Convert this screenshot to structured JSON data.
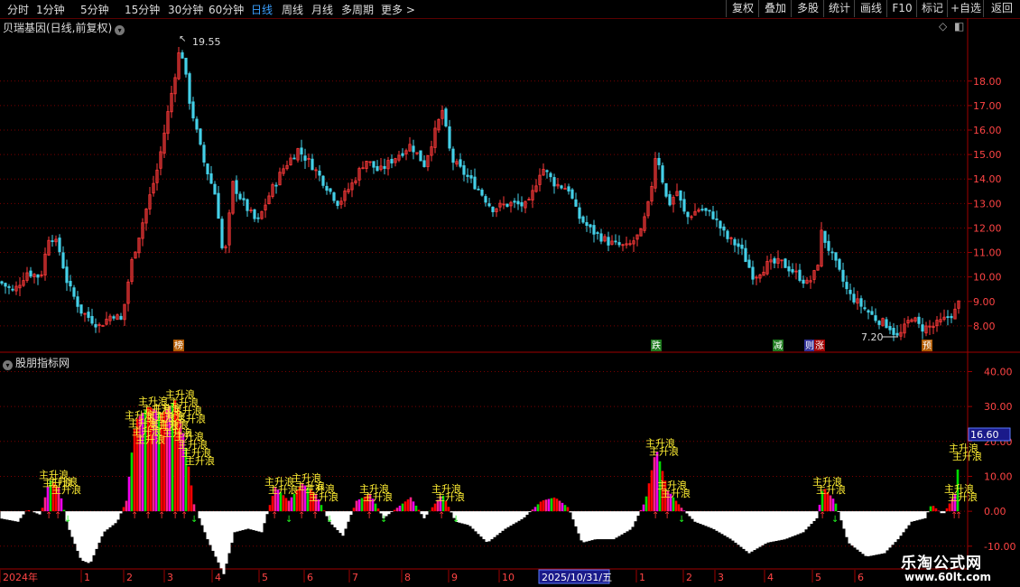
{
  "toolbar": {
    "periods": [
      "分时",
      "1分钟",
      "5分钟",
      "15分钟",
      "30分钟",
      "60分钟",
      "日线",
      "周线",
      "月线",
      "多周期",
      "更多"
    ],
    "active_period": "日线",
    "right_buttons": [
      "复权",
      "叠加",
      "多股",
      "统计",
      "画线",
      "F10",
      "标记",
      "+自选",
      "返回"
    ]
  },
  "main_panel": {
    "title": "贝瑞基因(日线,前复权)",
    "high_label": "19.55",
    "low_label": "7.20",
    "event_badges": [
      {
        "text": "榜",
        "color": "#b15a00",
        "x": 198
      },
      {
        "text": "跌",
        "color": "#1f7a1f",
        "x": 727
      },
      {
        "text": "减",
        "color": "#1f7a1f",
        "x": 862
      },
      {
        "text": "则",
        "color": "#333399",
        "x": 897
      },
      {
        "text": "涨",
        "color": "#a00000",
        "x": 908
      },
      {
        "text": "预",
        "color": "#b15a00",
        "x": 1027
      }
    ],
    "y_axis": {
      "min": 7.0,
      "max": 20.5,
      "ticks": [
        8,
        9,
        10,
        11,
        12,
        13,
        14,
        15,
        16,
        17,
        18
      ],
      "tick_labels": [
        "8.00",
        "9.00",
        "10.00",
        "11.00",
        "12.00",
        "13.00",
        "14.00",
        "15.00",
        "16.00",
        "17.00",
        "18.00"
      ]
    },
    "colors": {
      "up": "#ff3a3a",
      "down": "#44d0e8",
      "grid": "#7a0000"
    }
  },
  "sub_panel": {
    "title": "股朋指标网",
    "signal_label": "主升浪",
    "current_value_label": "16.60",
    "current_value": 16.6,
    "y_axis": {
      "min": -16,
      "max": 44,
      "ticks": [
        -10,
        0,
        10,
        20,
        30,
        40
      ],
      "tick_labels": [
        "-10.00",
        "0.00",
        "10.00",
        "20.00",
        "30.00",
        "40.00"
      ]
    }
  },
  "time_axis": {
    "labels": [
      {
        "text": "2024年",
        "x": 3
      },
      {
        "text": "1",
        "x": 93
      },
      {
        "text": "2",
        "x": 140
      },
      {
        "text": "3",
        "x": 185
      },
      {
        "text": "4",
        "x": 238
      },
      {
        "text": "5",
        "x": 290
      },
      {
        "text": "6",
        "x": 340
      },
      {
        "text": "7",
        "x": 390
      },
      {
        "text": "8",
        "x": 448
      },
      {
        "text": "9",
        "x": 500
      },
      {
        "text": "10",
        "x": 556
      },
      {
        "text": "1",
        "x": 708
      },
      {
        "text": "2",
        "x": 760
      },
      {
        "text": "3",
        "x": 795
      },
      {
        "text": "4",
        "x": 850
      },
      {
        "text": "5",
        "x": 903
      },
      {
        "text": "6",
        "x": 950
      }
    ],
    "cursor_date": "2025/10/31/五"
  },
  "chart_data": {
    "type": "line",
    "x_label": "",
    "y_label": "",
    "series": [
      {
        "points": [
          {
            "x": 0,
            "y": 9.8
          },
          {
            "x": 15,
            "y": 9.4
          },
          {
            "x": 30,
            "y": 10.2
          },
          {
            "x": 45,
            "y": 10.0
          },
          {
            "x": 55,
            "y": 11.8
          },
          {
            "x": 65,
            "y": 11.2
          },
          {
            "x": 75,
            "y": 9.7
          },
          {
            "x": 90,
            "y": 8.6
          },
          {
            "x": 110,
            "y": 8.0
          },
          {
            "x": 125,
            "y": 8.5
          },
          {
            "x": 135,
            "y": 8.2
          },
          {
            "x": 145,
            "y": 10.5
          },
          {
            "x": 160,
            "y": 12.5
          },
          {
            "x": 175,
            "y": 14.5
          },
          {
            "x": 185,
            "y": 16.5
          },
          {
            "x": 195,
            "y": 18.5
          },
          {
            "x": 200,
            "y": 19.5
          },
          {
            "x": 210,
            "y": 17.2
          },
          {
            "x": 225,
            "y": 14.8
          },
          {
            "x": 240,
            "y": 13.2
          },
          {
            "x": 248,
            "y": 10.5
          },
          {
            "x": 258,
            "y": 13.8
          },
          {
            "x": 270,
            "y": 13.0
          },
          {
            "x": 285,
            "y": 12.2
          },
          {
            "x": 300,
            "y": 13.5
          },
          {
            "x": 315,
            "y": 14.5
          },
          {
            "x": 330,
            "y": 15.2
          },
          {
            "x": 345,
            "y": 14.6
          },
          {
            "x": 360,
            "y": 13.8
          },
          {
            "x": 375,
            "y": 13.0
          },
          {
            "x": 390,
            "y": 13.8
          },
          {
            "x": 405,
            "y": 14.8
          },
          {
            "x": 420,
            "y": 14.3
          },
          {
            "x": 435,
            "y": 14.8
          },
          {
            "x": 455,
            "y": 15.4
          },
          {
            "x": 470,
            "y": 14.6
          },
          {
            "x": 490,
            "y": 16.8
          },
          {
            "x": 500,
            "y": 14.8
          },
          {
            "x": 515,
            "y": 14.2
          },
          {
            "x": 530,
            "y": 13.6
          },
          {
            "x": 545,
            "y": 12.8
          },
          {
            "x": 565,
            "y": 13.0
          },
          {
            "x": 585,
            "y": 12.9
          },
          {
            "x": 600,
            "y": 14.5
          },
          {
            "x": 615,
            "y": 13.8
          },
          {
            "x": 630,
            "y": 13.6
          },
          {
            "x": 640,
            "y": 12.5
          },
          {
            "x": 655,
            "y": 11.9
          },
          {
            "x": 675,
            "y": 11.4
          },
          {
            "x": 695,
            "y": 11.2
          },
          {
            "x": 710,
            "y": 11.8
          },
          {
            "x": 720,
            "y": 13.2
          },
          {
            "x": 727,
            "y": 15.2
          },
          {
            "x": 740,
            "y": 12.9
          },
          {
            "x": 750,
            "y": 13.5
          },
          {
            "x": 760,
            "y": 12.4
          },
          {
            "x": 775,
            "y": 12.8
          },
          {
            "x": 790,
            "y": 12.5
          },
          {
            "x": 805,
            "y": 11.6
          },
          {
            "x": 820,
            "y": 11.2
          },
          {
            "x": 835,
            "y": 10.0
          },
          {
            "x": 850,
            "y": 10.5
          },
          {
            "x": 865,
            "y": 10.6
          },
          {
            "x": 880,
            "y": 10.2
          },
          {
            "x": 895,
            "y": 9.7
          },
          {
            "x": 905,
            "y": 10.3
          },
          {
            "x": 910,
            "y": 11.8
          },
          {
            "x": 925,
            "y": 10.6
          },
          {
            "x": 940,
            "y": 9.3
          },
          {
            "x": 955,
            "y": 8.8
          },
          {
            "x": 970,
            "y": 8.3
          },
          {
            "x": 985,
            "y": 8.0
          },
          {
            "x": 995,
            "y": 7.5
          },
          {
            "x": 1010,
            "y": 8.4
          },
          {
            "x": 1020,
            "y": 7.9
          },
          {
            "x": 1035,
            "y": 8.0
          },
          {
            "x": 1048,
            "y": 8.3
          },
          {
            "x": 1058,
            "y": 8.6
          },
          {
            "x": 1063,
            "y": 9.0
          }
        ]
      },
      {
        "points": [
          {
            "x": 0,
            "y": -2
          },
          {
            "x": 20,
            "y": -3
          },
          {
            "x": 30,
            "y": 0.5
          },
          {
            "x": 45,
            "y": -1
          },
          {
            "x": 55,
            "y": 9
          },
          {
            "x": 65,
            "y": 7
          },
          {
            "x": 75,
            "y": -4
          },
          {
            "x": 90,
            "y": -14
          },
          {
            "x": 100,
            "y": -15
          },
          {
            "x": 115,
            "y": -6
          },
          {
            "x": 130,
            "y": -3
          },
          {
            "x": 140,
            "y": 3
          },
          {
            "x": 150,
            "y": 26
          },
          {
            "x": 165,
            "y": 30
          },
          {
            "x": 180,
            "y": 28
          },
          {
            "x": 195,
            "y": 32
          },
          {
            "x": 205,
            "y": 20
          },
          {
            "x": 215,
            "y": 2
          },
          {
            "x": 230,
            "y": -8
          },
          {
            "x": 248,
            "y": -18
          },
          {
            "x": 260,
            "y": -6
          },
          {
            "x": 275,
            "y": -5
          },
          {
            "x": 290,
            "y": -6
          },
          {
            "x": 305,
            "y": 7
          },
          {
            "x": 320,
            "y": 3
          },
          {
            "x": 335,
            "y": 8
          },
          {
            "x": 350,
            "y": 5
          },
          {
            "x": 365,
            "y": -3
          },
          {
            "x": 380,
            "y": -7
          },
          {
            "x": 395,
            "y": 3
          },
          {
            "x": 410,
            "y": 5
          },
          {
            "x": 425,
            "y": -2
          },
          {
            "x": 440,
            "y": 1
          },
          {
            "x": 455,
            "y": 4
          },
          {
            "x": 470,
            "y": -2
          },
          {
            "x": 490,
            "y": 5
          },
          {
            "x": 505,
            "y": -3
          },
          {
            "x": 520,
            "y": -4
          },
          {
            "x": 540,
            "y": -9
          },
          {
            "x": 560,
            "y": -5
          },
          {
            "x": 580,
            "y": -2
          },
          {
            "x": 600,
            "y": 3
          },
          {
            "x": 615,
            "y": 4
          },
          {
            "x": 630,
            "y": 1
          },
          {
            "x": 645,
            "y": -9
          },
          {
            "x": 660,
            "y": -8
          },
          {
            "x": 680,
            "y": -8
          },
          {
            "x": 700,
            "y": -5
          },
          {
            "x": 715,
            "y": 3
          },
          {
            "x": 727,
            "y": 18
          },
          {
            "x": 740,
            "y": 6
          },
          {
            "x": 755,
            "y": 1
          },
          {
            "x": 770,
            "y": -3
          },
          {
            "x": 790,
            "y": -5
          },
          {
            "x": 810,
            "y": -8
          },
          {
            "x": 830,
            "y": -12
          },
          {
            "x": 850,
            "y": -9
          },
          {
            "x": 870,
            "y": -8
          },
          {
            "x": 890,
            "y": -6
          },
          {
            "x": 905,
            "y": -2
          },
          {
            "x": 912,
            "y": 7
          },
          {
            "x": 925,
            "y": 3
          },
          {
            "x": 940,
            "y": -9
          },
          {
            "x": 960,
            "y": -13
          },
          {
            "x": 980,
            "y": -12
          },
          {
            "x": 995,
            "y": -8
          },
          {
            "x": 1010,
            "y": -3
          },
          {
            "x": 1025,
            "y": -2
          },
          {
            "x": 1032,
            "y": 2
          },
          {
            "x": 1045,
            "y": -1
          },
          {
            "x": 1058,
            "y": 5
          },
          {
            "x": 1063,
            "y": 16.6
          }
        ]
      }
    ]
  }
}
